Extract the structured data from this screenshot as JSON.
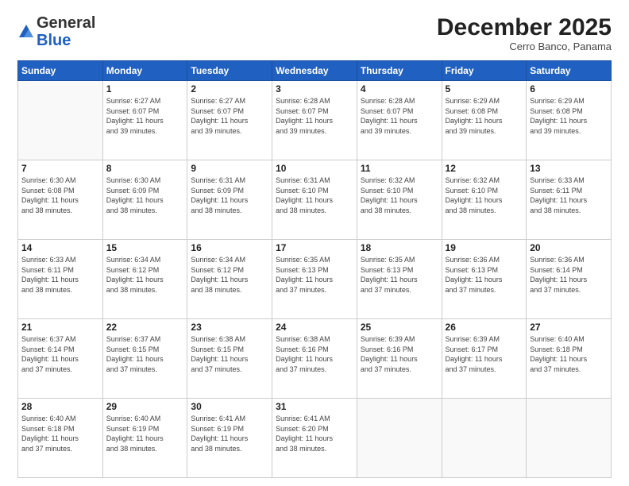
{
  "logo": {
    "general": "General",
    "blue": "Blue"
  },
  "title": {
    "month": "December 2025",
    "location": "Cerro Banco, Panama"
  },
  "weekdays": [
    "Sunday",
    "Monday",
    "Tuesday",
    "Wednesday",
    "Thursday",
    "Friday",
    "Saturday"
  ],
  "weeks": [
    [
      {
        "day": "",
        "info": ""
      },
      {
        "day": "1",
        "info": "Sunrise: 6:27 AM\nSunset: 6:07 PM\nDaylight: 11 hours\nand 39 minutes."
      },
      {
        "day": "2",
        "info": "Sunrise: 6:27 AM\nSunset: 6:07 PM\nDaylight: 11 hours\nand 39 minutes."
      },
      {
        "day": "3",
        "info": "Sunrise: 6:28 AM\nSunset: 6:07 PM\nDaylight: 11 hours\nand 39 minutes."
      },
      {
        "day": "4",
        "info": "Sunrise: 6:28 AM\nSunset: 6:07 PM\nDaylight: 11 hours\nand 39 minutes."
      },
      {
        "day": "5",
        "info": "Sunrise: 6:29 AM\nSunset: 6:08 PM\nDaylight: 11 hours\nand 39 minutes."
      },
      {
        "day": "6",
        "info": "Sunrise: 6:29 AM\nSunset: 6:08 PM\nDaylight: 11 hours\nand 39 minutes."
      }
    ],
    [
      {
        "day": "7",
        "info": "Sunrise: 6:30 AM\nSunset: 6:08 PM\nDaylight: 11 hours\nand 38 minutes."
      },
      {
        "day": "8",
        "info": "Sunrise: 6:30 AM\nSunset: 6:09 PM\nDaylight: 11 hours\nand 38 minutes."
      },
      {
        "day": "9",
        "info": "Sunrise: 6:31 AM\nSunset: 6:09 PM\nDaylight: 11 hours\nand 38 minutes."
      },
      {
        "day": "10",
        "info": "Sunrise: 6:31 AM\nSunset: 6:10 PM\nDaylight: 11 hours\nand 38 minutes."
      },
      {
        "day": "11",
        "info": "Sunrise: 6:32 AM\nSunset: 6:10 PM\nDaylight: 11 hours\nand 38 minutes."
      },
      {
        "day": "12",
        "info": "Sunrise: 6:32 AM\nSunset: 6:10 PM\nDaylight: 11 hours\nand 38 minutes."
      },
      {
        "day": "13",
        "info": "Sunrise: 6:33 AM\nSunset: 6:11 PM\nDaylight: 11 hours\nand 38 minutes."
      }
    ],
    [
      {
        "day": "14",
        "info": "Sunrise: 6:33 AM\nSunset: 6:11 PM\nDaylight: 11 hours\nand 38 minutes."
      },
      {
        "day": "15",
        "info": "Sunrise: 6:34 AM\nSunset: 6:12 PM\nDaylight: 11 hours\nand 38 minutes."
      },
      {
        "day": "16",
        "info": "Sunrise: 6:34 AM\nSunset: 6:12 PM\nDaylight: 11 hours\nand 38 minutes."
      },
      {
        "day": "17",
        "info": "Sunrise: 6:35 AM\nSunset: 6:13 PM\nDaylight: 11 hours\nand 37 minutes."
      },
      {
        "day": "18",
        "info": "Sunrise: 6:35 AM\nSunset: 6:13 PM\nDaylight: 11 hours\nand 37 minutes."
      },
      {
        "day": "19",
        "info": "Sunrise: 6:36 AM\nSunset: 6:13 PM\nDaylight: 11 hours\nand 37 minutes."
      },
      {
        "day": "20",
        "info": "Sunrise: 6:36 AM\nSunset: 6:14 PM\nDaylight: 11 hours\nand 37 minutes."
      }
    ],
    [
      {
        "day": "21",
        "info": "Sunrise: 6:37 AM\nSunset: 6:14 PM\nDaylight: 11 hours\nand 37 minutes."
      },
      {
        "day": "22",
        "info": "Sunrise: 6:37 AM\nSunset: 6:15 PM\nDaylight: 11 hours\nand 37 minutes."
      },
      {
        "day": "23",
        "info": "Sunrise: 6:38 AM\nSunset: 6:15 PM\nDaylight: 11 hours\nand 37 minutes."
      },
      {
        "day": "24",
        "info": "Sunrise: 6:38 AM\nSunset: 6:16 PM\nDaylight: 11 hours\nand 37 minutes."
      },
      {
        "day": "25",
        "info": "Sunrise: 6:39 AM\nSunset: 6:16 PM\nDaylight: 11 hours\nand 37 minutes."
      },
      {
        "day": "26",
        "info": "Sunrise: 6:39 AM\nSunset: 6:17 PM\nDaylight: 11 hours\nand 37 minutes."
      },
      {
        "day": "27",
        "info": "Sunrise: 6:40 AM\nSunset: 6:18 PM\nDaylight: 11 hours\nand 37 minutes."
      }
    ],
    [
      {
        "day": "28",
        "info": "Sunrise: 6:40 AM\nSunset: 6:18 PM\nDaylight: 11 hours\nand 37 minutes."
      },
      {
        "day": "29",
        "info": "Sunrise: 6:40 AM\nSunset: 6:19 PM\nDaylight: 11 hours\nand 38 minutes."
      },
      {
        "day": "30",
        "info": "Sunrise: 6:41 AM\nSunset: 6:19 PM\nDaylight: 11 hours\nand 38 minutes."
      },
      {
        "day": "31",
        "info": "Sunrise: 6:41 AM\nSunset: 6:20 PM\nDaylight: 11 hours\nand 38 minutes."
      },
      {
        "day": "",
        "info": ""
      },
      {
        "day": "",
        "info": ""
      },
      {
        "day": "",
        "info": ""
      }
    ]
  ]
}
